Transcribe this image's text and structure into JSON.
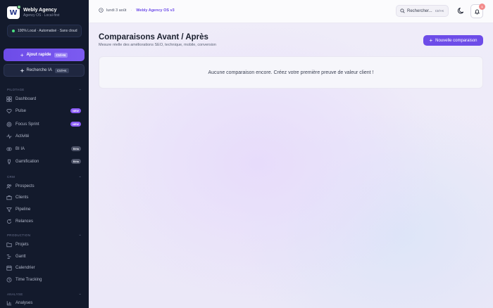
{
  "brand": {
    "name": "Webly Agency",
    "subtitle": "Agency OS · Local-first",
    "logo_letter": "W"
  },
  "status_pill": "100% Local · Automatisé · Sans cloud",
  "quick_add": {
    "label": "Ajout rapide",
    "shortcut": "Ctrl+N"
  },
  "ai_search": {
    "label": "Recherche IA",
    "shortcut": "Ctrl+K"
  },
  "sections": {
    "pilotage": "PILOTAGE",
    "crm": "CRM",
    "production": "PRODUCTION",
    "analyse": "ANALYSE"
  },
  "nav": {
    "dashboard": "Dashboard",
    "pulse": "Pulse",
    "pulse_badge": "NEW",
    "focus": "Focus Sprint",
    "focus_badge": "NEW",
    "activite": "Activité",
    "bi": "BI IA",
    "bi_badge": "Bêta",
    "gamification": "Gamification",
    "gamification_badge": "Bêta",
    "prospects": "Prospects",
    "clients": "Clients",
    "pipeline": "Pipeline",
    "relances": "Relances",
    "projets": "Projets",
    "gantt": "Gantt",
    "calendrier": "Calendrier",
    "time": "Time Tracking",
    "analyses": "Analyses"
  },
  "header": {
    "date": "lundi 3 août",
    "version": "Webly Agency OS v3",
    "search_label": "Rechercher...",
    "search_shortcut": "Ctrl+K",
    "notif_count": "1"
  },
  "main": {
    "title": "Comparaisons Avant / Après",
    "subtitle": "Mesure réelle des améliorations SEO, technique, mobile, conversion",
    "new_button": "Nouvelle comparaison",
    "empty_text": "Aucune comparaison encore. Créez votre première preuve de valeur client !"
  },
  "colors": {
    "accent": "#6d4ce8",
    "sidebar": "#131a2c",
    "new_badge": "#8b5cf6"
  }
}
